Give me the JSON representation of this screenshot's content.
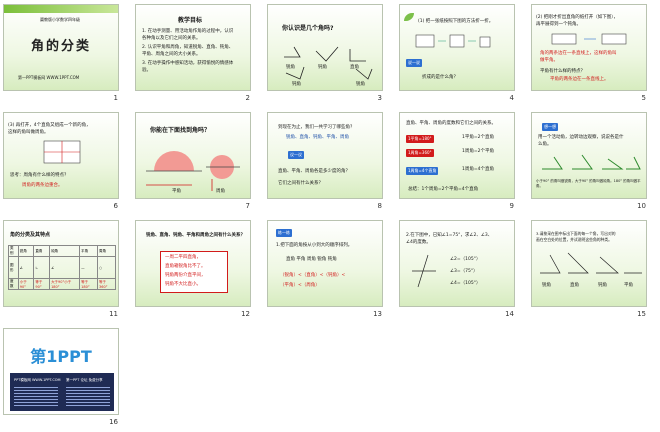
{
  "slides": [
    {
      "num": "1",
      "top_label": "冀教版小学数学四年级",
      "title": "角的分类",
      "footer": "第一PPT模板网 WWW.1PPT.COM"
    },
    {
      "num": "2",
      "heading": "教学目标",
      "lines": [
        "1. 在动手测量、用活动角作角的过程中，认识",
        "各种角以及它们之间的关系。",
        "2. 认识平角和周角，知道锐角、直角、钝角、",
        "平角、周角之间的大小关系。",
        "3. 在动手操作中感知活动，获得愉悦的情感体",
        "验。"
      ]
    },
    {
      "num": "3",
      "heading": "你认识是几个角吗?",
      "labels": [
        "锐角",
        "钝角",
        "直角",
        "钝角",
        "锐角"
      ]
    },
    {
      "num": "4",
      "lines": [
        "(1) 把一张纸按照下图的方法折一折。"
      ],
      "badge": "说一说",
      "question": "折成的是什么角？"
    },
    {
      "num": "5",
      "lines": [
        "(2) 把刚才折出直角的纸打开（如下图），",
        "再平展得到一个钝角。"
      ],
      "red1": "角的两条边在一条直线上，这样的角叫",
      "red1b": "做平角。",
      "q": "平角有什么样的特点？",
      "red2": "平角的两条边在一条直线上。"
    },
    {
      "num": "6",
      "lines": [
        "(3) 再打开，4个直角又组成一个新的角，",
        "这样的角叫做周角。"
      ],
      "q": "思考：周角有什么样的特点？",
      "red": "周角的两条边重合。"
    },
    {
      "num": "7",
      "heading": "你能在下面找到角吗？",
      "labels": [
        "平角",
        "周角"
      ]
    },
    {
      "num": "8",
      "heading": "到现在为止，我们一共学习了哪些角？",
      "blue": "锐角、直角、钝角、平角、周角",
      "badge": "议一议",
      "q1": "直角、平角、周角各是多少度的角？",
      "q2": "它们之间有什么关系？"
    },
    {
      "num": "9",
      "heading": "直角、平角、周角的度数和它们之间的关系。",
      "rows": [
        [
          "1平角=180°",
          "1平角=2个直角"
        ],
        [
          "1周角=360°",
          "1周角=2个平角"
        ],
        [
          "1周角=4个直角",
          "1周角=4个直角"
        ]
      ],
      "foot": "总结：1个周角=2个平角=4个直角"
    },
    {
      "num": "10",
      "badge": "想一想",
      "lines": [
        "用一个活动角，边转动边观察，说说各是什",
        "么角。"
      ],
      "foot": "小于90° 的角叫做锐角，大于90° 的角叫做钝角。180° 的角叫做平角。"
    },
    {
      "num": "11",
      "heading": "角的分类及其特点",
      "cols": [
        "类别",
        "锐角",
        "直角",
        "钝角",
        "平角",
        "周角"
      ],
      "row2": [
        "图形"
      ],
      "row3": [
        "度数",
        "小于90°",
        "等于90°",
        "大于90°小于180°",
        "等于180°",
        "等于360°"
      ]
    },
    {
      "num": "12",
      "heading": "锐角、直角、钝角、平角和周角之间有什么关系？",
      "box": [
        "一周二平四直角，",
        "直角箱锐角比不了。",
        "钝角两份介直平间，",
        "钝角不大比直小。"
      ]
    },
    {
      "num": "13",
      "badge": "练一练",
      "lines": [
        "1.把下面的角按从小到大的顺序排列。",
        "直角  平角  周角  锐角  钝角"
      ],
      "ans": [
        "（锐角）<（直角）<（钝角）<",
        "（平角）<（周角）"
      ]
    },
    {
      "num": "14",
      "lines": [
        "2.在下图中，已知∠1=75°，求∠2、∠3、",
        "∠4的度数。"
      ],
      "ans": [
        "∠2=（105°）",
        "∠3=（75°）",
        "∠4=（105°）"
      ]
    },
    {
      "num": "15",
      "lines": [
        "3.请按采在图中标出下面的每一个角，写出对的",
        "画在空白处的位置，并试说明这些角的种类。"
      ],
      "labels": [
        "锐角",
        "直角",
        "钝角",
        "平角"
      ]
    },
    {
      "num": "16",
      "logo": "第1PPT",
      "sub1": "PPT模板网 WWW.1PPT.COM",
      "sub2": "第一PPT 论坛 免费分享"
    }
  ],
  "colors": {
    "green": "#7bbf3a",
    "red": "#d21b1b",
    "blue": "#1d4fa8"
  }
}
